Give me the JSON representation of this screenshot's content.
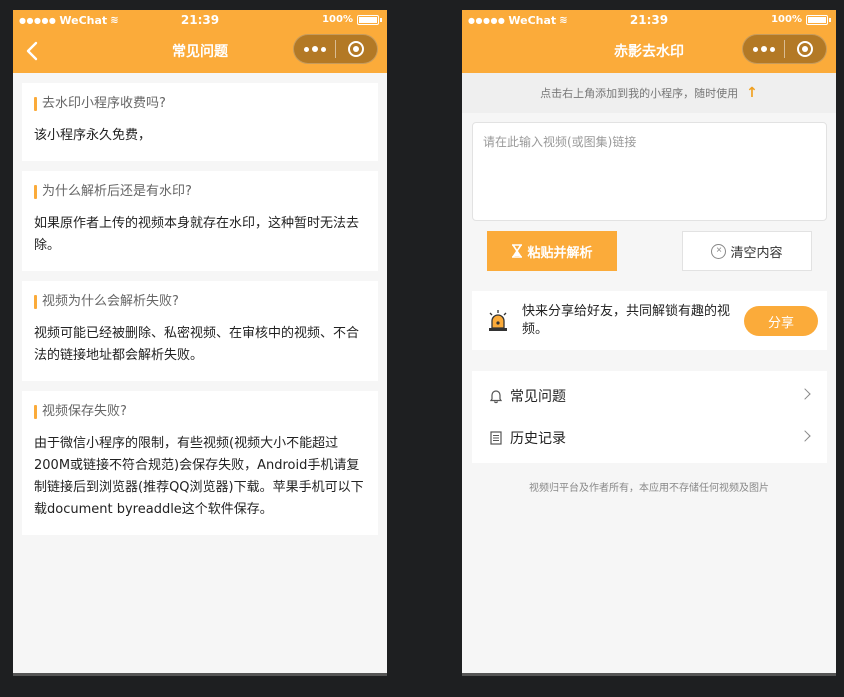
{
  "status_bar": {
    "carrier": "WeChat",
    "time": "21:39",
    "battery": "100%"
  },
  "faq_page": {
    "title": "常见问题",
    "items": [
      {
        "q": "去水印小程序收费吗?",
        "a": "该小程序永久免费，"
      },
      {
        "q": "为什么解析后还是有水印?",
        "a": "如果原作者上传的视频本身就存在水印，这种暂时无法去除。"
      },
      {
        "q": "视频为什么会解析失败?",
        "a": "视频可能已经被删除、私密视频、在审核中的视频、不合法的链接地址都会解析失败。"
      },
      {
        "q": "视频保存失败?",
        "a": "由于微信小程序的限制，有些视频(视频大小不能超过200M或链接不符合规范)会保存失败，Android手机请复制链接后到浏览器(推荐QQ浏览器)下载。苹果手机可以下载document byreaddle这个软件保存。"
      }
    ]
  },
  "main_page": {
    "title": "赤影去水印",
    "tip": "点击右上角添加到我的小程序，随时使用",
    "input_placeholder": "请在此输入视频(或图集)链接",
    "paste_button": "粘贴并解析",
    "clear_button": "清空内容",
    "share_text": "快来分享给好友，共同解锁有趣的视频。",
    "share_button": "分享",
    "menu": [
      {
        "label": "常见问题",
        "icon": "bell-icon"
      },
      {
        "label": "历史记录",
        "icon": "document-icon"
      }
    ],
    "footer": "视频归平台及作者所有，本应用不存储任何视频及图片"
  },
  "colors": {
    "accent": "#fbab3a",
    "background": "#1e1f21"
  }
}
